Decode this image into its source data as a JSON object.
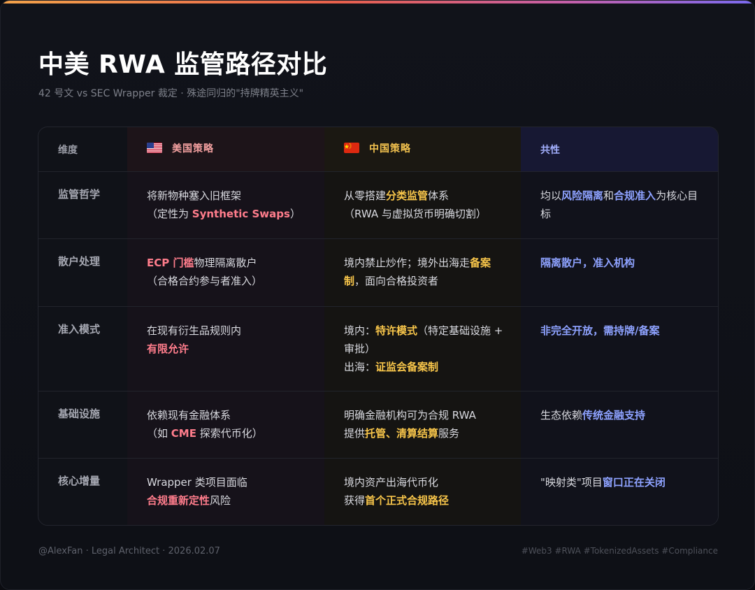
{
  "title": "中美 RWA 监管路径对比",
  "subtitle": "42 号文 vs SEC Wrapper 裁定 · 殊途同归的\"持牌精英主义\"",
  "colors": {
    "accent_red": "#ff7d8c",
    "accent_yellow": "#f7c54a",
    "accent_blue": "#8ea2ff"
  },
  "headers": {
    "dimension": "维度",
    "us": "美国策略",
    "us_flag": "us-flag-icon",
    "cn": "中国策略",
    "cn_flag": "cn-flag-icon",
    "common": "共性"
  },
  "rows": [
    {
      "dimension": "监管哲学",
      "us": [
        [
          "将新物种塞入旧框架",
          ""
        ],
        [
          "（定性为 ",
          ""
        ],
        [
          "Synthetic Swaps",
          "r"
        ],
        [
          "）",
          ""
        ]
      ],
      "us_breaks": [
        0
      ],
      "cn": [
        [
          "从零搭建",
          ""
        ],
        [
          "分类监管",
          "y"
        ],
        [
          "体系",
          ""
        ],
        [
          "（RWA 与虚拟货币明确切割）",
          ""
        ]
      ],
      "cn_breaks": [
        2
      ],
      "common": [
        [
          "均以",
          ""
        ],
        [
          "风险隔离",
          "b"
        ],
        [
          "和",
          ""
        ],
        [
          "合规准入",
          "b"
        ],
        [
          "为核心目标",
          ""
        ]
      ],
      "common_breaks": []
    },
    {
      "dimension": "散户处理",
      "us": [
        [
          "ECP 门槛",
          "r"
        ],
        [
          "物理隔离散户",
          ""
        ],
        [
          "（合格合约参与者准入）",
          ""
        ]
      ],
      "us_breaks": [
        1
      ],
      "cn": [
        [
          "境内禁止炒作；境外出海走",
          ""
        ],
        [
          "备案制",
          "y"
        ],
        [
          "，面向合格投资者",
          ""
        ]
      ],
      "cn_breaks": [],
      "common": [
        [
          "隔离散户，准入机构",
          "b"
        ]
      ],
      "common_breaks": []
    },
    {
      "dimension": "准入模式",
      "us": [
        [
          "在现有衍生品规则内",
          ""
        ],
        [
          "有限允许",
          "r"
        ]
      ],
      "us_breaks": [
        0
      ],
      "cn": [
        [
          "境内：",
          ""
        ],
        [
          "特许模式",
          "y"
        ],
        [
          "（特定基础设施 + 审批）",
          ""
        ],
        [
          "出海：",
          ""
        ],
        [
          "证监会备案制",
          "y"
        ]
      ],
      "cn_breaks": [
        2
      ],
      "common": [
        [
          "非完全开放，需持牌/备案",
          "b"
        ]
      ],
      "common_breaks": []
    },
    {
      "dimension": "基础设施",
      "us": [
        [
          "依赖现有金融体系",
          ""
        ],
        [
          "（如 ",
          ""
        ],
        [
          "CME",
          "r"
        ],
        [
          " 探索代币化）",
          ""
        ]
      ],
      "us_breaks": [
        0
      ],
      "cn": [
        [
          "明确金融机构可为合规 RWA",
          ""
        ],
        [
          "提供",
          ""
        ],
        [
          "托管、清算结算",
          "y"
        ],
        [
          "服务",
          ""
        ]
      ],
      "cn_breaks": [
        0
      ],
      "common": [
        [
          "生态依赖",
          ""
        ],
        [
          "传统金融支持",
          "b"
        ]
      ],
      "common_breaks": []
    },
    {
      "dimension": "核心增量",
      "us": [
        [
          "Wrapper 类项目面临",
          ""
        ],
        [
          "合规重新定性",
          "r"
        ],
        [
          "风险",
          ""
        ]
      ],
      "us_breaks": [
        0
      ],
      "cn": [
        [
          "境内资产出海代币化",
          ""
        ],
        [
          "获得",
          ""
        ],
        [
          "首个正式合规路径",
          "y"
        ]
      ],
      "cn_breaks": [
        0
      ],
      "common": [
        [
          "\"映射类\"项目",
          ""
        ],
        [
          "窗口正在关闭",
          "b"
        ]
      ],
      "common_breaks": []
    }
  ],
  "footer": {
    "author": "@AlexFan · Legal Architect · 2026.02.07",
    "tags": "#Web3 #RWA #TokenizedAssets #Compliance"
  }
}
